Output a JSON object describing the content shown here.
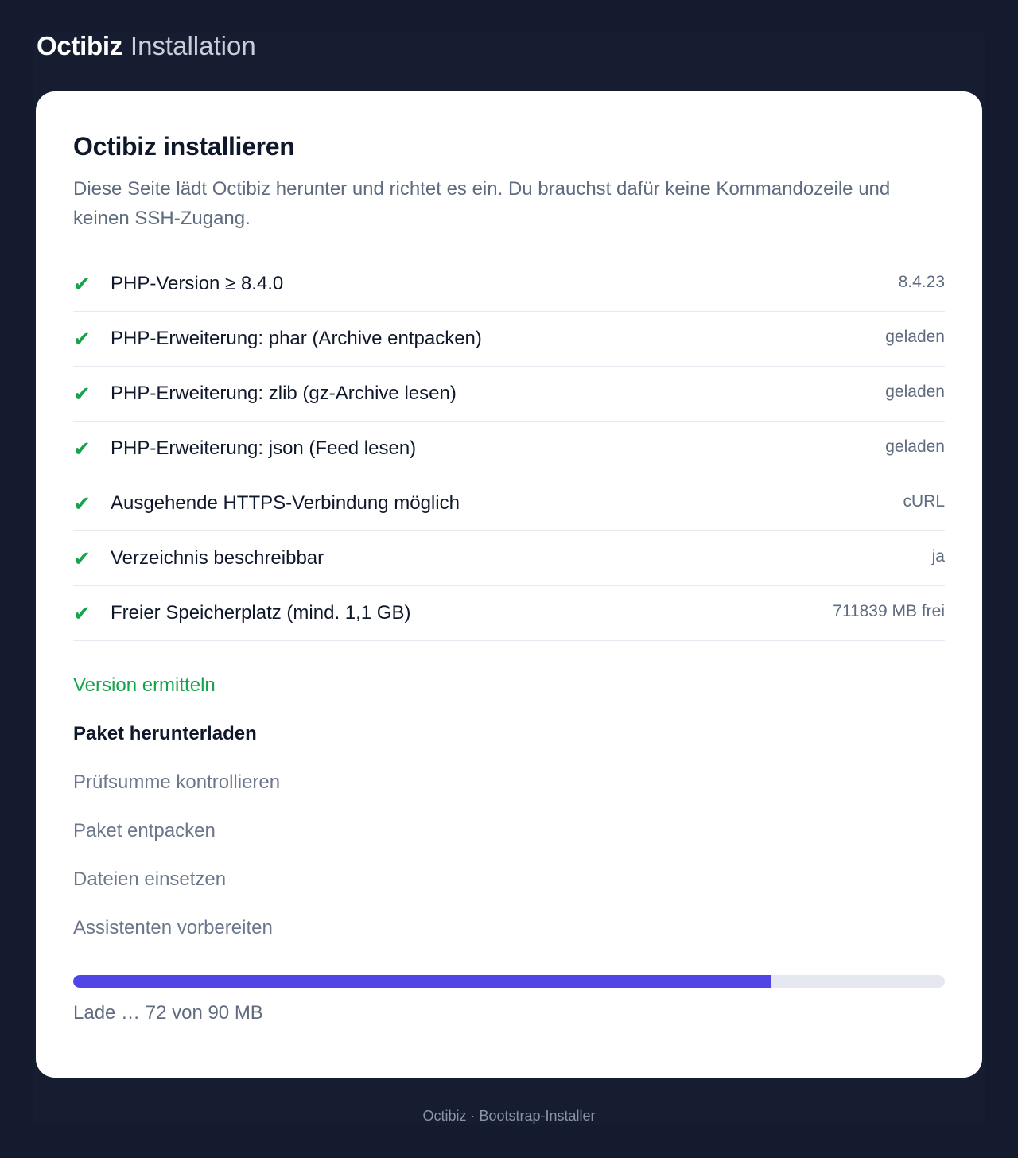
{
  "header": {
    "brand_name": "Octibiz",
    "brand_sub": "Installation"
  },
  "card": {
    "title": "Octibiz installieren",
    "intro": "Diese Seite lädt Octibiz herunter und richtet es ein. Du brauchst dafür keine Kommandozeile und keinen SSH-Zugang."
  },
  "checks": [
    {
      "icon": "check-icon",
      "glyph": "✔",
      "label": "PHP-Version ≥ 8.4.0",
      "value": "8.4.23"
    },
    {
      "icon": "check-icon",
      "glyph": "✔",
      "label": "PHP-Erweiterung: phar (Archive entpacken)",
      "value": "geladen"
    },
    {
      "icon": "check-icon",
      "glyph": "✔",
      "label": "PHP-Erweiterung: zlib (gz-Archive lesen)",
      "value": "geladen"
    },
    {
      "icon": "check-icon",
      "glyph": "✔",
      "label": "PHP-Erweiterung: json (Feed lesen)",
      "value": "geladen"
    },
    {
      "icon": "check-icon",
      "glyph": "✔",
      "label": "Ausgehende HTTPS-Verbindung möglich",
      "value": "cURL"
    },
    {
      "icon": "check-icon",
      "glyph": "✔",
      "label": "Verzeichnis beschreibbar",
      "value": "ja"
    },
    {
      "icon": "check-icon",
      "glyph": "✔",
      "label": "Freier Speicherplatz (mind. 1,1 GB)",
      "value": "711839 MB frei"
    }
  ],
  "steps": [
    {
      "label": "Version ermitteln",
      "state": "done"
    },
    {
      "label": "Paket herunterladen",
      "state": "active"
    },
    {
      "label": "Prüfsumme kontrollieren",
      "state": "pending"
    },
    {
      "label": "Paket entpacken",
      "state": "pending"
    },
    {
      "label": "Dateien einsetzen",
      "state": "pending"
    },
    {
      "label": "Assistenten vorbereiten",
      "state": "pending"
    }
  ],
  "progress": {
    "fraction": 0.8,
    "text": "Lade … 72 von 90 MB"
  },
  "colors": {
    "success": "#16a34a",
    "accent": "#4f46e5",
    "background": "#151b2e"
  },
  "footer": {
    "text": "Octibiz · Bootstrap-Installer"
  }
}
